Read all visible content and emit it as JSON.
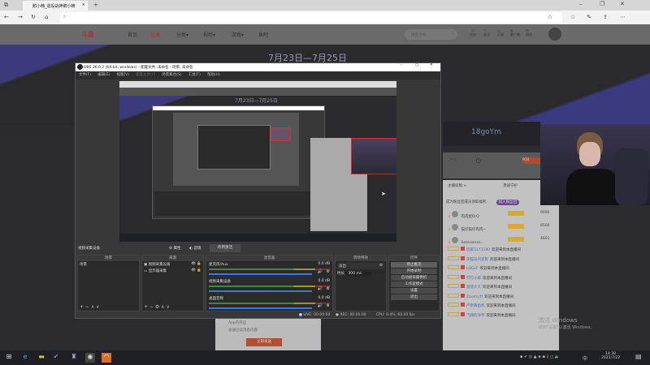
{
  "browser": {
    "tab_title": "鹅小楠_退役战神鹅小楠",
    "url": ""
  },
  "site": {
    "nav": [
      "首页",
      "直播",
      "分类▾",
      "视频▾",
      "游戏▾",
      "鱼吧"
    ],
    "search_placeholder": "搜索主播",
    "icons": [
      "历史",
      "关注",
      "订阅",
      "客户端",
      "消息"
    ],
    "banner_date": "7月23日—7月25日",
    "stream_id": "18goYm"
  },
  "obs": {
    "title": "OBS 26.0.2 (64-bit, windows) - 配置文件: 未命名 - 场景: 未命名",
    "menu": [
      "文件(F)",
      "编辑(E)",
      "视图(V)",
      "配置文件(P)",
      "场景集合(S)",
      "工具(T)",
      "帮助(H)"
    ],
    "source_bar": {
      "selected": "视频采集设备",
      "properties": "属性",
      "filters": "滤镜",
      "deactivate": "停用激活"
    },
    "scenes": {
      "header": "场景",
      "items": [
        "场景"
      ]
    },
    "sources": {
      "header": "来源",
      "items": [
        "视频采集设备",
        "显示器采集"
      ]
    },
    "mixer": {
      "header": "混音器",
      "channels": [
        {
          "name": "麦克风/Aux",
          "db": "0.0 dB"
        },
        {
          "name": "视频采集设备",
          "db": "0.0 dB"
        },
        {
          "name": "桌面音频",
          "db": "0.0 dB"
        }
      ]
    },
    "transitions": {
      "header": "转场特效",
      "type": "淡出",
      "duration_label": "时长",
      "duration": "300 ms"
    },
    "controls": {
      "header": "控件",
      "buttons": [
        "停止推流",
        "开始录制",
        "启动虚拟摄像机",
        "工作室模式",
        "设置",
        "退出"
      ]
    },
    "status": {
      "live_label": "LIVE:",
      "live_time": "00:00:00",
      "rec_label": "REC:",
      "rec_time": "00:00:00",
      "cpu": "CPU: 0.4%, 60.00 fps"
    }
  },
  "chat": {
    "tabs": [
      "主播投稿 >",
      "贵族守护"
    ],
    "notice": "成为粉丝团成员领取福利",
    "fan_button": "加入粉丝团",
    "rank": [
      {
        "name": "肉肉屋DrQ",
        "score": "9000"
      },
      {
        "name": "猫仔猫仔肉肉~",
        "score": "8500"
      },
      {
        "name": "Ssssssssss...",
        "score": "4601"
      }
    ],
    "messages": [
      {
        "user": "玩家5173180",
        "text": "欢迎来到本直播间"
      },
      {
        "user": "天猫异闪星影",
        "text": "欢迎来到本直播间"
      },
      {
        "user": "LQGLF",
        "text": "欢迎来到本直播间"
      },
      {
        "user": "钉钉小郎",
        "text": "欢迎来到本直播间"
      },
      {
        "user": "溜溜大大",
        "text": "欢迎来到本直播间"
      },
      {
        "user": "Zoomy力",
        "text": "欢迎来到本直播间"
      },
      {
        "user": "严肃骨齿机",
        "text": "欢迎来到本直播间"
      },
      {
        "user": "飞翔的洋宇",
        "text": "欢迎来到本直播间"
      }
    ]
  },
  "card": {
    "line1": "App内开启",
    "line2": "发送已读消息内容",
    "button": "立即发送"
  },
  "watermark": {
    "title": "激活 Windows",
    "sub": "转到\"设置\"以激活 Windows。"
  },
  "taskbar": {
    "time": "14:38",
    "date": "2021/7/22",
    "ime": "中"
  }
}
